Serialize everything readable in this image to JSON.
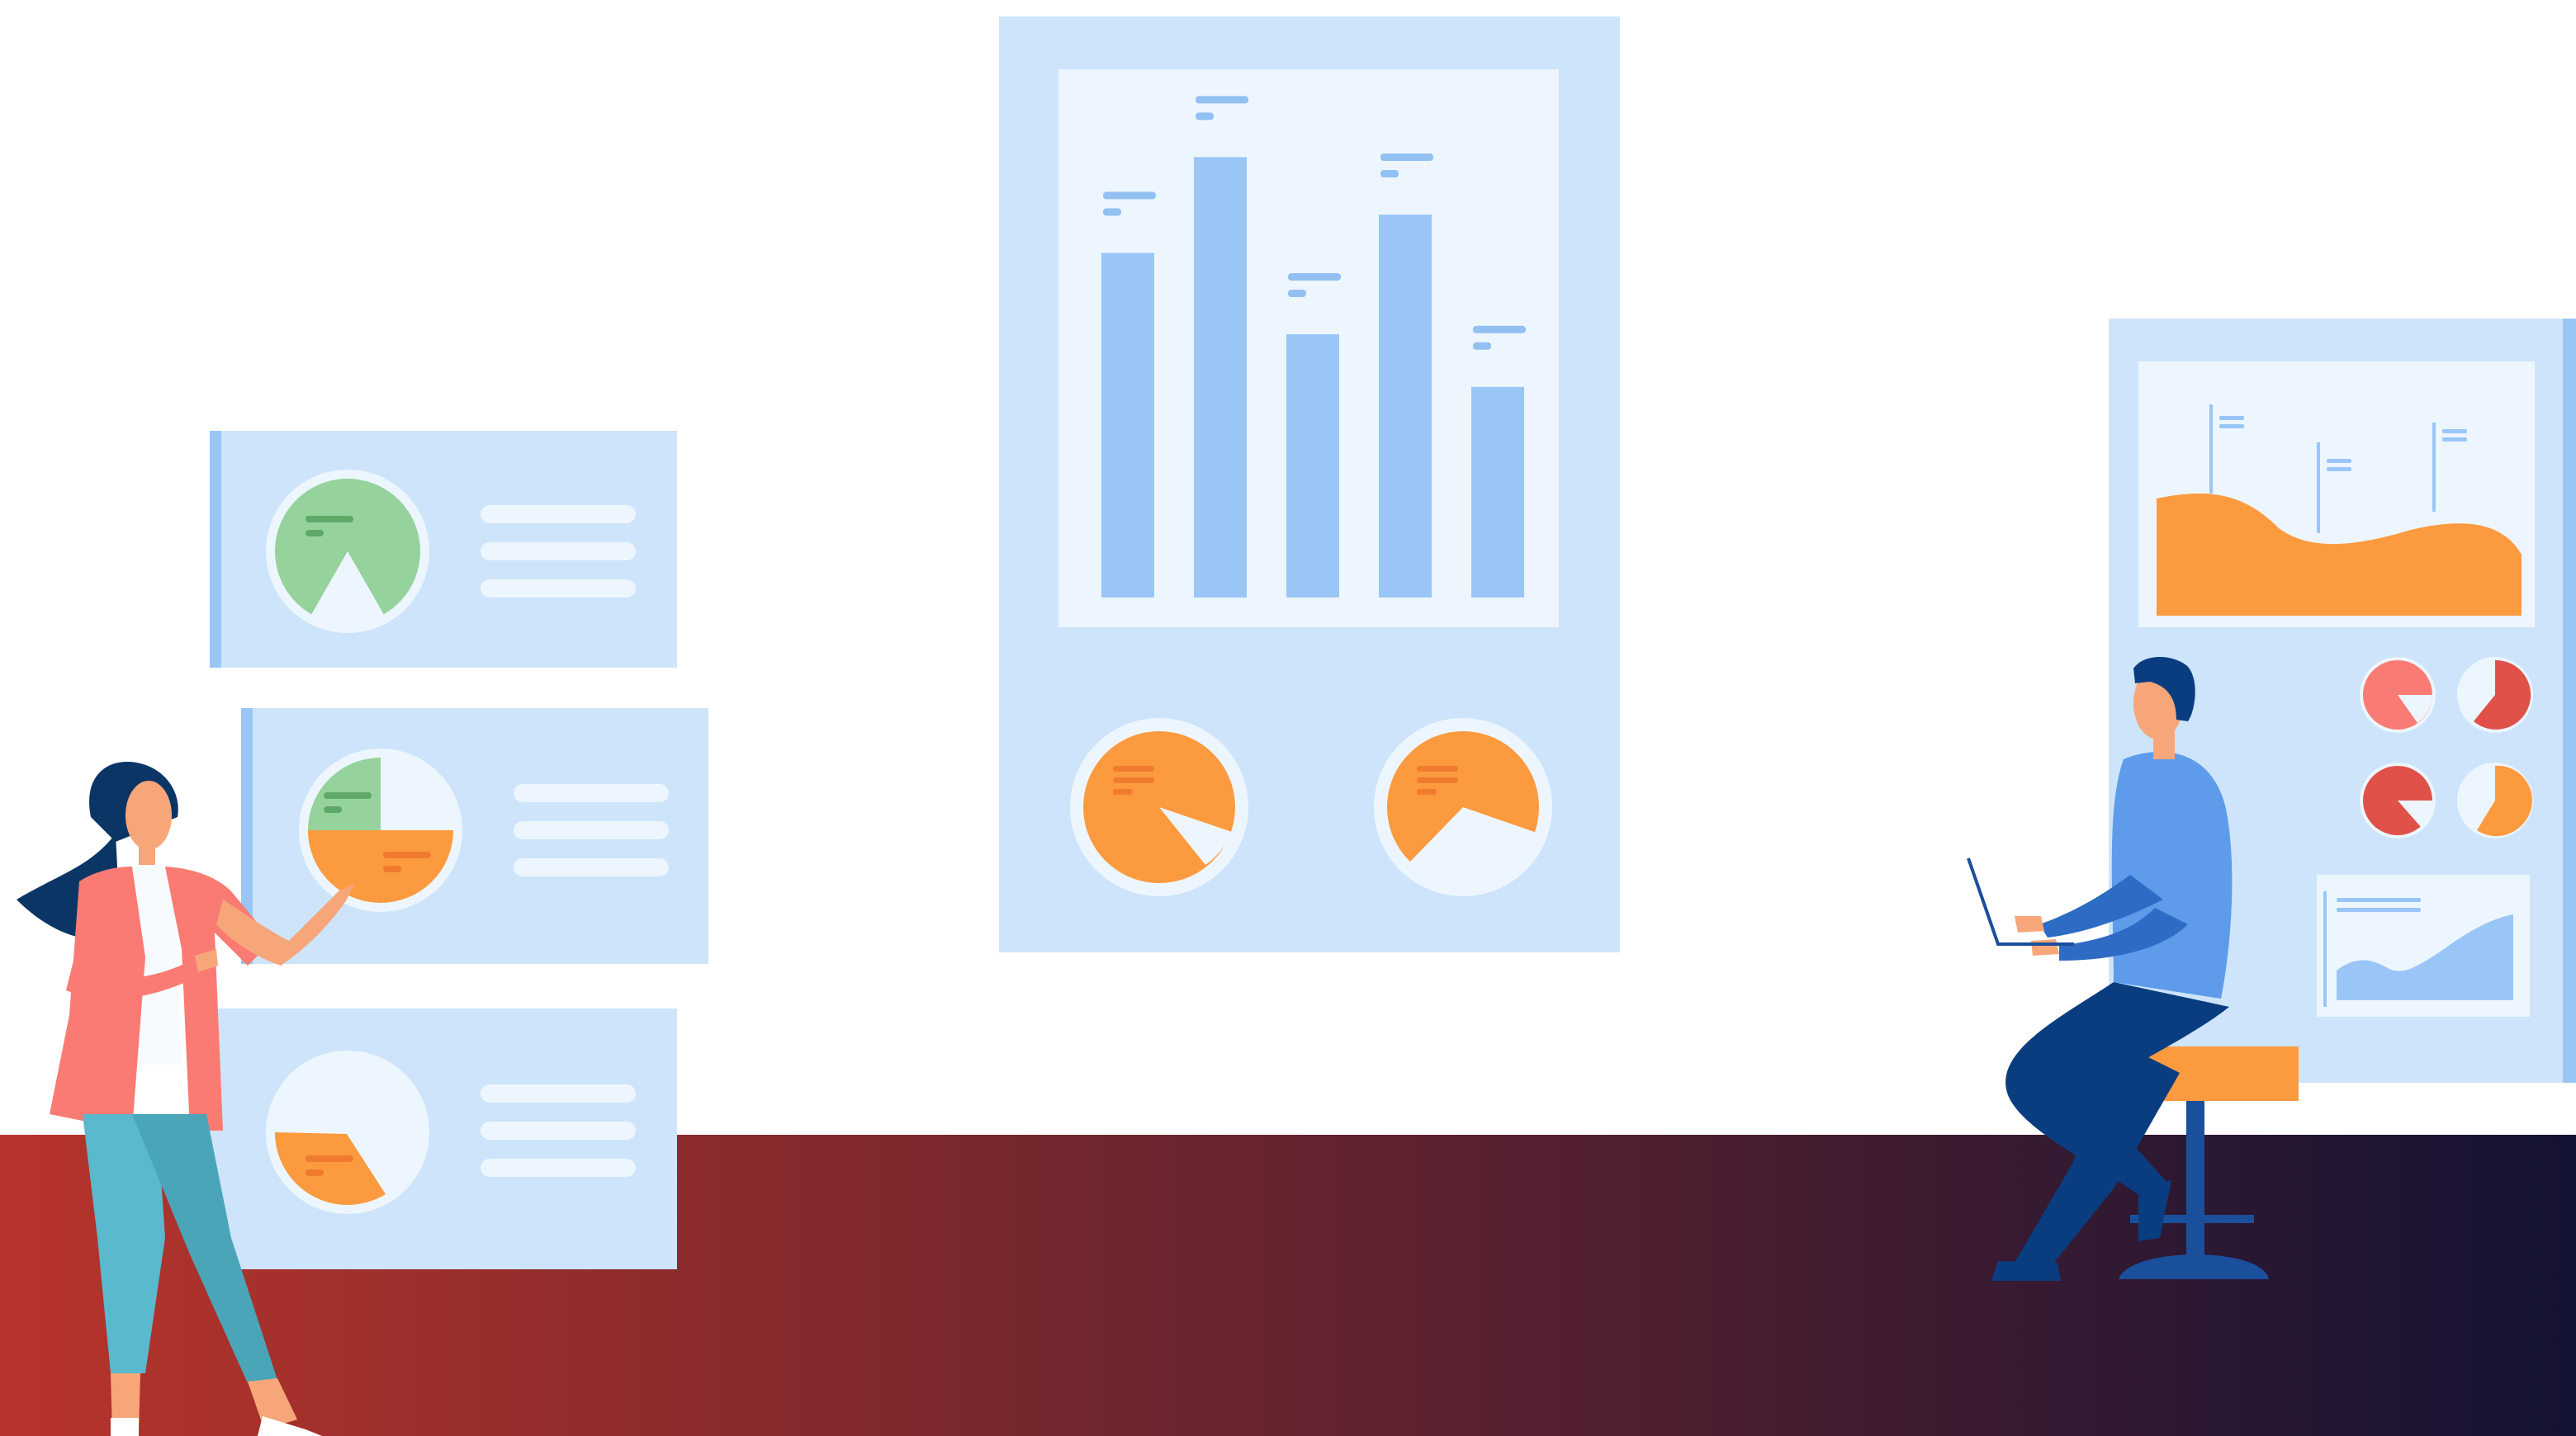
{
  "colors": {
    "panel": "#cde4fb",
    "panel_inner": "#edf6fe",
    "bar": "#99c6f7",
    "bar_label": "#93c0f3",
    "line": "#ffffff",
    "orange": "#fc9a3f",
    "orange_dark": "#f07b2f",
    "green": "#95d29c",
    "green_dark": "#5fa968",
    "red": "#e0514a",
    "salmon": "#fa7b73",
    "floor_left": "#b7342b",
    "floor_right": "#141333",
    "navy": "#0a3d80",
    "shirt": "#5e9bea",
    "stool": "#fc9a3f",
    "stool_leg": "#1a4f9c",
    "jacket": "#fa7b73",
    "pants": "#5ab9cc",
    "hair": "#0b3565",
    "skin": "#f7a679"
  },
  "chart_data": {
    "type": "bar",
    "categories": [
      "",
      "",
      "",
      "",
      ""
    ],
    "values": [
      0.72,
      0.92,
      0.55,
      0.8,
      0.44
    ],
    "ylim": [
      0,
      1
    ],
    "grid": false
  },
  "icons": [
    "pie-chart-icon",
    "bar-chart-icon",
    "area-chart-icon",
    "laptop-icon"
  ]
}
